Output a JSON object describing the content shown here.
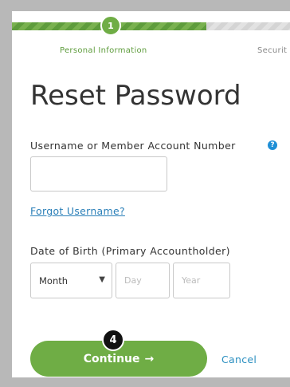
{
  "progress": {
    "step_number": "1",
    "fraction_complete": 0.7,
    "steps": [
      {
        "label": "Personal Information"
      },
      {
        "label": "Securit"
      }
    ]
  },
  "page_title": "Reset Password",
  "username": {
    "label": "Username or Member Account Number",
    "value": "",
    "help_icon": "question-circle-icon"
  },
  "forgot_username_link": "Forgot Username?",
  "dob": {
    "label": "Date of Birth (Primary Accountholder)",
    "month_selected": "Month",
    "day_placeholder": "Day",
    "year_placeholder": "Year"
  },
  "actions": {
    "continue_label": "Continue",
    "continue_icon": "arrow-right-icon",
    "cancel_label": "Cancel"
  },
  "annotation_badge": "4",
  "colors": {
    "accent_green": "#6fad45",
    "link_blue": "#2a7fb8",
    "help_blue": "#1f8fd6"
  }
}
